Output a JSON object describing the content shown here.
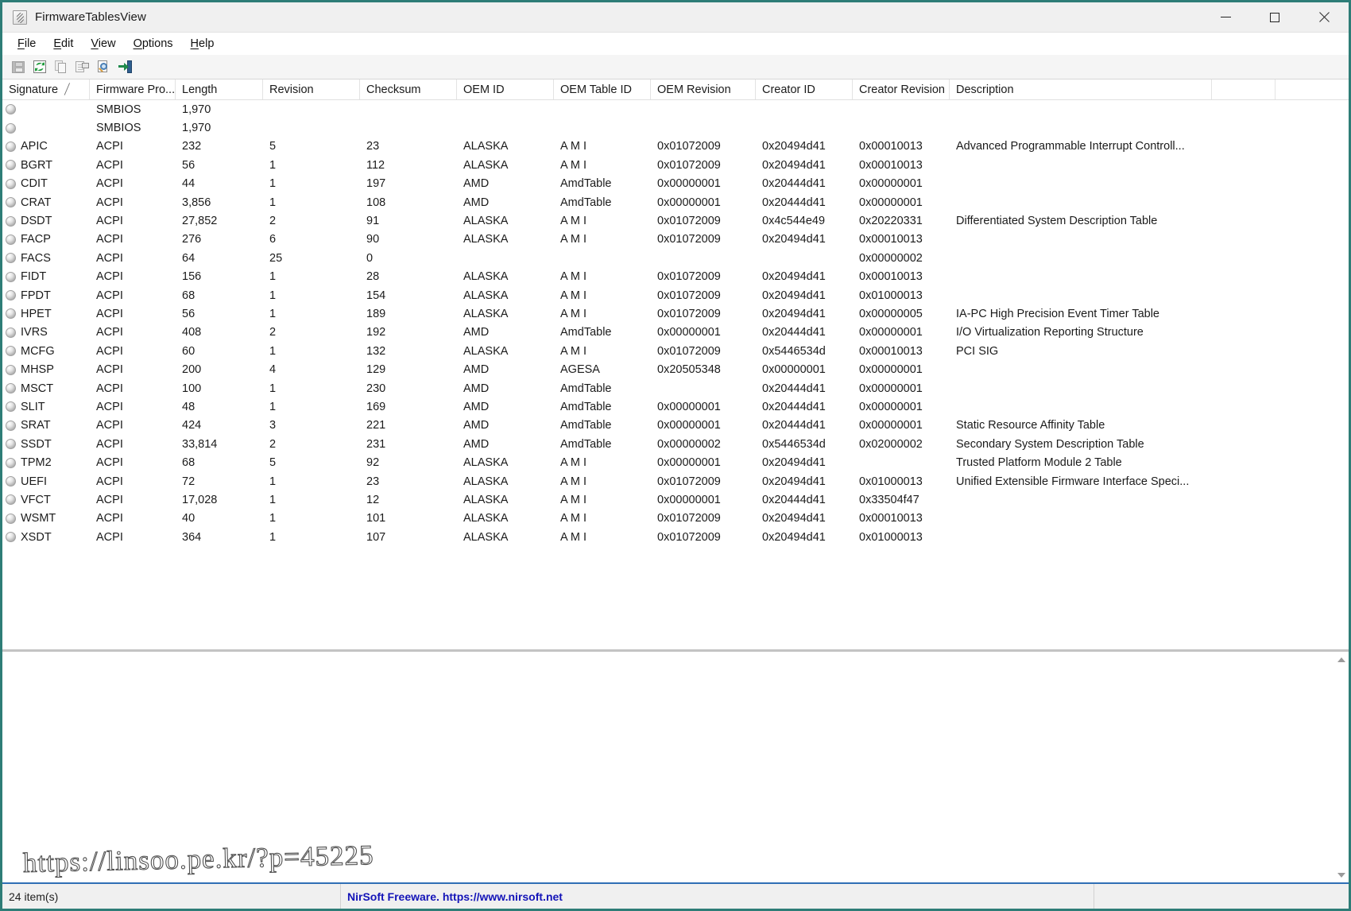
{
  "window": {
    "title": "FirmwareTablesView",
    "app_icon": "firmware-tables-icon",
    "minimize_label": "Minimize",
    "maximize_label": "Maximize",
    "close_label": "Close"
  },
  "menu": [
    {
      "label": "File",
      "accel": "F"
    },
    {
      "label": "Edit",
      "accel": "E"
    },
    {
      "label": "View",
      "accel": "V"
    },
    {
      "label": "Options",
      "accel": "O"
    },
    {
      "label": "Help",
      "accel": "H"
    }
  ],
  "toolbar": [
    {
      "name": "save-icon",
      "label": "Save Selected Items"
    },
    {
      "name": "refresh-icon",
      "label": "Refresh"
    },
    {
      "name": "copy-icon",
      "label": "Copy Selected Items"
    },
    {
      "name": "properties-icon",
      "label": "Properties"
    },
    {
      "name": "html-report-icon",
      "label": "HTML Report - All Items"
    },
    {
      "name": "exit-icon",
      "label": "Exit"
    }
  ],
  "table": {
    "sort_column": "Signature",
    "sort_indicator": "╱",
    "columns": [
      "Signature",
      "Firmware Pro...",
      "Length",
      "Revision",
      "Checksum",
      "OEM ID",
      "OEM Table ID",
      "OEM Revision",
      "Creator ID",
      "Creator Revision",
      "Description"
    ],
    "rows": [
      {
        "signature": "",
        "provider": "SMBIOS",
        "length": "1,970",
        "revision": "",
        "checksum": "",
        "oem_id": "",
        "oem_table_id": "",
        "oem_revision": "",
        "creator_id": "",
        "creator_revision": "",
        "description": ""
      },
      {
        "signature": "",
        "provider": "SMBIOS",
        "length": "1,970",
        "revision": "",
        "checksum": "",
        "oem_id": "",
        "oem_table_id": "",
        "oem_revision": "",
        "creator_id": "",
        "creator_revision": "",
        "description": ""
      },
      {
        "signature": "APIC",
        "provider": "ACPI",
        "length": "232",
        "revision": "5",
        "checksum": "23",
        "oem_id": "ALASKA",
        "oem_table_id": "A M I",
        "oem_revision": "0x01072009",
        "creator_id": "0x20494d41",
        "creator_revision": "0x00010013",
        "description": "Advanced Programmable Interrupt Controll..."
      },
      {
        "signature": "BGRT",
        "provider": "ACPI",
        "length": "56",
        "revision": "1",
        "checksum": "112",
        "oem_id": "ALASKA",
        "oem_table_id": "A M I",
        "oem_revision": "0x01072009",
        "creator_id": "0x20494d41",
        "creator_revision": "0x00010013",
        "description": ""
      },
      {
        "signature": "CDIT",
        "provider": "ACPI",
        "length": "44",
        "revision": "1",
        "checksum": "197",
        "oem_id": "AMD",
        "oem_table_id": "AmdTable",
        "oem_revision": "0x00000001",
        "creator_id": "0x20444d41",
        "creator_revision": "0x00000001",
        "description": ""
      },
      {
        "signature": "CRAT",
        "provider": "ACPI",
        "length": "3,856",
        "revision": "1",
        "checksum": "108",
        "oem_id": "AMD",
        "oem_table_id": "AmdTable",
        "oem_revision": "0x00000001",
        "creator_id": "0x20444d41",
        "creator_revision": "0x00000001",
        "description": ""
      },
      {
        "signature": "DSDT",
        "provider": "ACPI",
        "length": "27,852",
        "revision": "2",
        "checksum": "91",
        "oem_id": "ALASKA",
        "oem_table_id": "A M I",
        "oem_revision": "0x01072009",
        "creator_id": "0x4c544e49",
        "creator_revision": "0x20220331",
        "description": "Differentiated System Description Table"
      },
      {
        "signature": "FACP",
        "provider": "ACPI",
        "length": "276",
        "revision": "6",
        "checksum": "90",
        "oem_id": "ALASKA",
        "oem_table_id": "A M I",
        "oem_revision": "0x01072009",
        "creator_id": "0x20494d41",
        "creator_revision": "0x00010013",
        "description": ""
      },
      {
        "signature": "FACS",
        "provider": "ACPI",
        "length": "64",
        "revision": "25",
        "checksum": "0",
        "oem_id": "",
        "oem_table_id": "",
        "oem_revision": "",
        "creator_id": "",
        "creator_revision": "0x00000002",
        "description": ""
      },
      {
        "signature": "FIDT",
        "provider": "ACPI",
        "length": "156",
        "revision": "1",
        "checksum": "28",
        "oem_id": "ALASKA",
        "oem_table_id": "A M I",
        "oem_revision": "0x01072009",
        "creator_id": "0x20494d41",
        "creator_revision": "0x00010013",
        "description": ""
      },
      {
        "signature": "FPDT",
        "provider": "ACPI",
        "length": "68",
        "revision": "1",
        "checksum": "154",
        "oem_id": "ALASKA",
        "oem_table_id": "A M I",
        "oem_revision": "0x01072009",
        "creator_id": "0x20494d41",
        "creator_revision": "0x01000013",
        "description": ""
      },
      {
        "signature": "HPET",
        "provider": "ACPI",
        "length": "56",
        "revision": "1",
        "checksum": "189",
        "oem_id": "ALASKA",
        "oem_table_id": "A M I",
        "oem_revision": "0x01072009",
        "creator_id": "0x20494d41",
        "creator_revision": "0x00000005",
        "description": "IA-PC High Precision Event Timer Table"
      },
      {
        "signature": "IVRS",
        "provider": "ACPI",
        "length": "408",
        "revision": "2",
        "checksum": "192",
        "oem_id": "AMD",
        "oem_table_id": "AmdTable",
        "oem_revision": "0x00000001",
        "creator_id": "0x20444d41",
        "creator_revision": "0x00000001",
        "description": "I/O Virtualization Reporting Structure"
      },
      {
        "signature": "MCFG",
        "provider": "ACPI",
        "length": "60",
        "revision": "1",
        "checksum": "132",
        "oem_id": "ALASKA",
        "oem_table_id": "A M I",
        "oem_revision": "0x01072009",
        "creator_id": "0x5446534d",
        "creator_revision": "0x00010013",
        "description": "PCI SIG"
      },
      {
        "signature": "MHSP",
        "provider": "ACPI",
        "length": "200",
        "revision": "4",
        "checksum": "129",
        "oem_id": "AMD",
        "oem_table_id": "AGESA",
        "oem_revision": "0x20505348",
        "creator_id": "0x00000001",
        "creator_revision": "0x00000001",
        "description": ""
      },
      {
        "signature": "MSCT",
        "provider": "ACPI",
        "length": "100",
        "revision": "1",
        "checksum": "230",
        "oem_id": "AMD",
        "oem_table_id": "AmdTable",
        "oem_revision": "",
        "creator_id": "0x20444d41",
        "creator_revision": "0x00000001",
        "description": ""
      },
      {
        "signature": "SLIT",
        "provider": "ACPI",
        "length": "48",
        "revision": "1",
        "checksum": "169",
        "oem_id": "AMD",
        "oem_table_id": "AmdTable",
        "oem_revision": "0x00000001",
        "creator_id": "0x20444d41",
        "creator_revision": "0x00000001",
        "description": ""
      },
      {
        "signature": "SRAT",
        "provider": "ACPI",
        "length": "424",
        "revision": "3",
        "checksum": "221",
        "oem_id": "AMD",
        "oem_table_id": "AmdTable",
        "oem_revision": "0x00000001",
        "creator_id": "0x20444d41",
        "creator_revision": "0x00000001",
        "description": "Static Resource Affinity Table"
      },
      {
        "signature": "SSDT",
        "provider": "ACPI",
        "length": "33,814",
        "revision": "2",
        "checksum": "231",
        "oem_id": "AMD",
        "oem_table_id": "AmdTable",
        "oem_revision": "0x00000002",
        "creator_id": "0x5446534d",
        "creator_revision": "0x02000002",
        "description": "Secondary System Description Table"
      },
      {
        "signature": "TPM2",
        "provider": "ACPI",
        "length": "68",
        "revision": "5",
        "checksum": "92",
        "oem_id": "ALASKA",
        "oem_table_id": "A M I",
        "oem_revision": "0x00000001",
        "creator_id": "0x20494d41",
        "creator_revision": "",
        "description": "Trusted Platform Module 2 Table"
      },
      {
        "signature": "UEFI",
        "provider": "ACPI",
        "length": "72",
        "revision": "1",
        "checksum": "23",
        "oem_id": "ALASKA",
        "oem_table_id": "A M I",
        "oem_revision": "0x01072009",
        "creator_id": "0x20494d41",
        "creator_revision": "0x01000013",
        "description": "Unified Extensible Firmware Interface Speci..."
      },
      {
        "signature": "VFCT",
        "provider": "ACPI",
        "length": "17,028",
        "revision": "1",
        "checksum": "12",
        "oem_id": "ALASKA",
        "oem_table_id": "A M I",
        "oem_revision": "0x00000001",
        "creator_id": "0x20444d41",
        "creator_revision": "0x33504f47",
        "description": ""
      },
      {
        "signature": "WSMT",
        "provider": "ACPI",
        "length": "40",
        "revision": "1",
        "checksum": "101",
        "oem_id": "ALASKA",
        "oem_table_id": "A M I",
        "oem_revision": "0x01072009",
        "creator_id": "0x20494d41",
        "creator_revision": "0x00010013",
        "description": ""
      },
      {
        "signature": "XSDT",
        "provider": "ACPI",
        "length": "364",
        "revision": "1",
        "checksum": "107",
        "oem_id": "ALASKA",
        "oem_table_id": "A M I",
        "oem_revision": "0x01072009",
        "creator_id": "0x20494d41",
        "creator_revision": "0x01000013",
        "description": ""
      }
    ]
  },
  "statusbar": {
    "item_count": "24 item(s)",
    "credit": "NirSoft Freeware. https://www.nirsoft.net"
  },
  "watermark": {
    "text": "https://linsoo.pe.kr/?p=45225"
  },
  "colors": {
    "window_border": "#2e7d77",
    "status_accent": "#2f6fb5",
    "credit_link": "#1414b8"
  }
}
